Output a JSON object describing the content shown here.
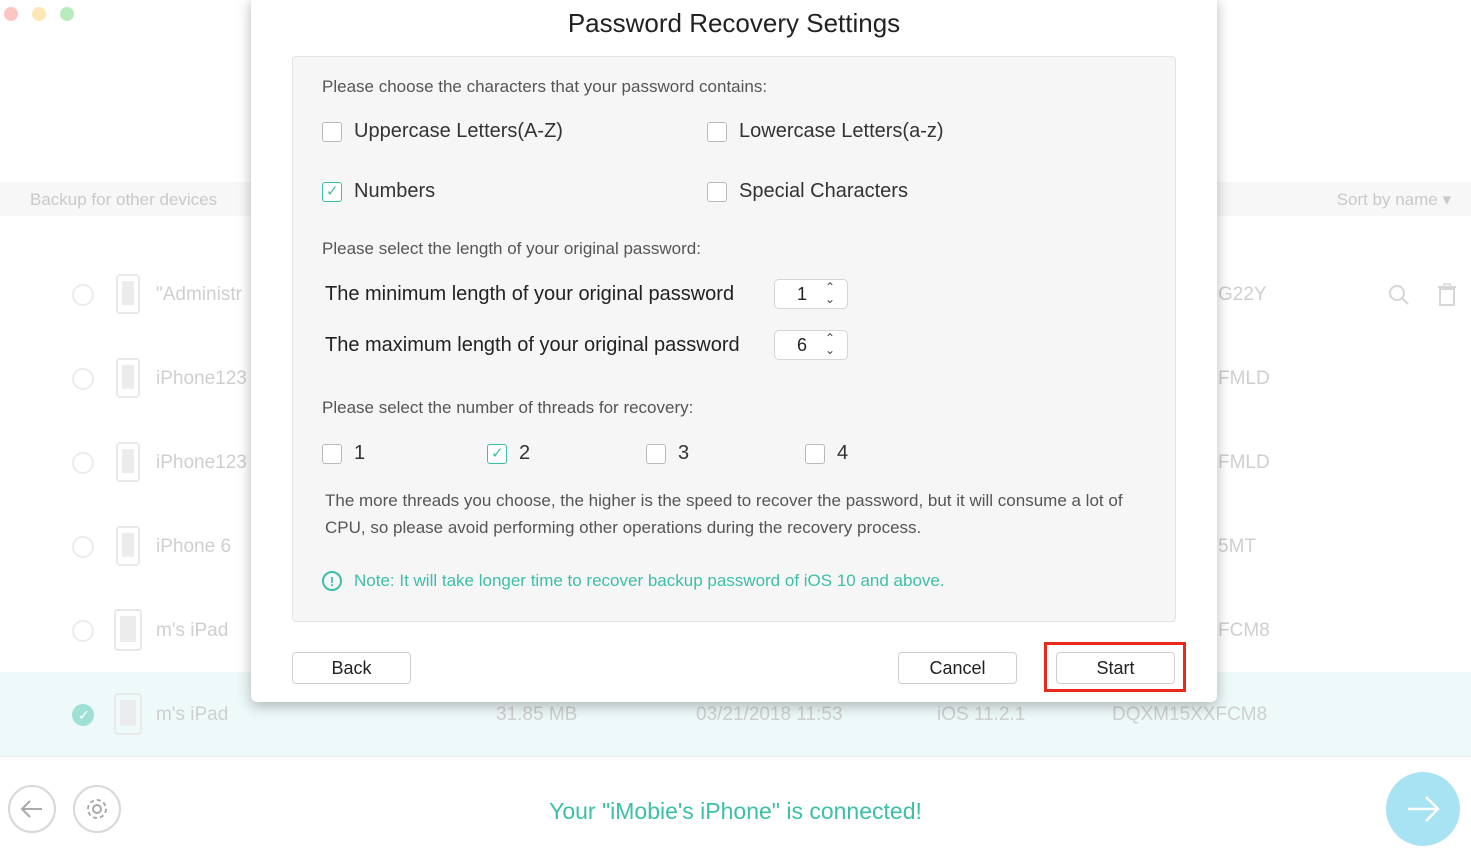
{
  "background": {
    "header_left": "Backup for other devices",
    "sort_label": "Sort by name ▾",
    "rows": [
      {
        "name": "\"Administr",
        "serial": "G22Y",
        "icon": "iphone"
      },
      {
        "name": "iPhone123",
        "serial": "FMLD",
        "icon": "iphone"
      },
      {
        "name": "iPhone123",
        "serial": "FMLD",
        "icon": "iphone"
      },
      {
        "name": "iPhone 6",
        "serial": "5MT",
        "icon": "iphone"
      },
      {
        "name": "m's iPad",
        "serial": "FCM8",
        "icon": "ipad"
      },
      {
        "name": "m's iPad",
        "size": "31.85 MB",
        "date": "03/21/2018 11:53",
        "ios": "iOS 11.2.1",
        "serial": "DQXM15XXFCM8",
        "icon": "ipad",
        "selected": true
      }
    ],
    "connected_text": "Your \"iMobie's iPhone\" is connected!"
  },
  "dialog": {
    "title": "Password Recovery Settings",
    "chars_label": "Please choose the characters that your password contains:",
    "char_options": [
      {
        "label": "Uppercase Letters(A-Z)",
        "checked": false
      },
      {
        "label": "Lowercase Letters(a-z)",
        "checked": false
      },
      {
        "label": "Numbers",
        "checked": true
      },
      {
        "label": "Special Characters",
        "checked": false
      }
    ],
    "length_label": "Please select the length of your original password:",
    "min_label": "The minimum length of your original password",
    "min_value": "1",
    "max_label": "The maximum length of your original password",
    "max_value": "6",
    "threads_label": "Please select the number of threads for recovery:",
    "threads": [
      {
        "label": "1",
        "checked": false
      },
      {
        "label": "2",
        "checked": true
      },
      {
        "label": "3",
        "checked": false
      },
      {
        "label": "4",
        "checked": false
      }
    ],
    "threads_note": "The more threads you choose, the higher is the speed to recover the password, but it will consume a lot of CPU, so please avoid performing other operations during the recovery process.",
    "warning": "Note: It will take longer time to recover backup password of iOS 10 and above.",
    "back_label": "Back",
    "cancel_label": "Cancel",
    "start_label": "Start"
  },
  "colors": {
    "accent": "#3cbfa7",
    "highlight": "#e8291c"
  }
}
